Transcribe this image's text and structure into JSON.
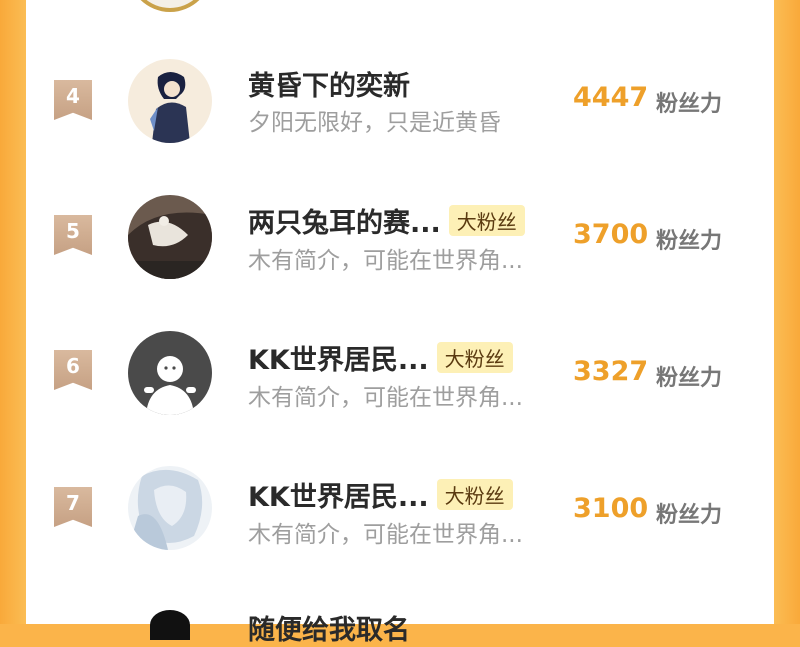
{
  "label_fans": "粉丝力",
  "rows": [
    {
      "rank": "4",
      "name": "黄昏下的奕新",
      "badge": "",
      "desc": "夕阳无限好，只是近黄昏",
      "count": "4447"
    },
    {
      "rank": "5",
      "name": "两只兔耳的赛...",
      "badge": "大粉丝",
      "desc": "木有简介，可能在世界角...",
      "count": "3700"
    },
    {
      "rank": "6",
      "name": "KK世界居民...",
      "badge": "大粉丝",
      "desc": "木有简介，可能在世界角...",
      "count": "3327"
    },
    {
      "rank": "7",
      "name": "KK世界居民...",
      "badge": "大粉丝",
      "desc": "木有简介，可能在世界角...",
      "count": "3100"
    }
  ],
  "next_row": {
    "name": "随便给我取名"
  },
  "colors": {
    "accent": "#eea02a",
    "badge_bg": "#fdf0b6",
    "rank_bg": "#d9b99e",
    "border": "#f9a93a"
  }
}
